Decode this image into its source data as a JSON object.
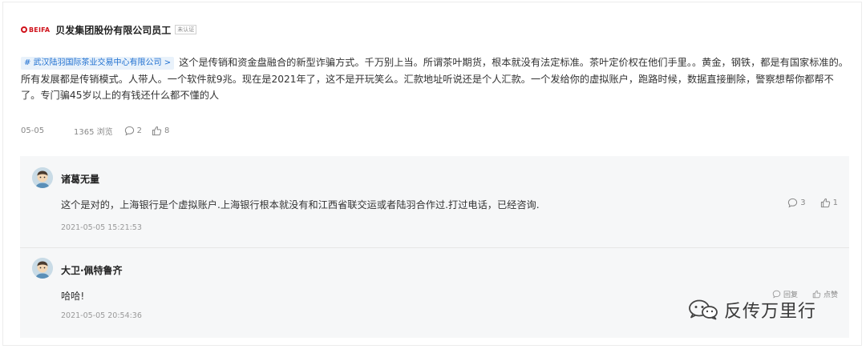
{
  "author": {
    "logo_text": "BEIFA",
    "name": "贝发集团股份有限公司员工",
    "badge": "未认证"
  },
  "post": {
    "topic": "# 武汉陆羽国际茶业交易中心有限公司 >",
    "content": "这个是传销和资金盘融合的新型诈骗方式。千万别上当。所谓茶叶期货，根本就没有法定标准。茶叶定价权在他们手里。。黄金，钢铁，都是有国家标准的。所有发展都是传销模式。人带人。一个软件就9兆。现在是2021年了，这不是开玩笑么。汇款地址听说还是个人汇款。一个发给你的虚拟账户，跑路时候，数据直接删除，警察想帮你都帮不了。专门骗45岁以上的有钱还什么都不懂的人",
    "date": "05-05",
    "views": "1365 浏览",
    "comments": "2",
    "likes": "8"
  },
  "comments": [
    {
      "name": "诸葛无量",
      "text": "这个是对的，上海银行是个虚拟账户.上海银行根本就没有和江西省联交运或者陆羽合作过.打过电话，已经咨询.",
      "time": "2021-05-05 15:21:53",
      "replies": "3",
      "likes": "1"
    },
    {
      "name": "大卫·佩特鲁齐",
      "text": "哈哈!",
      "time": "2021-05-05 20:54:36",
      "reply_label": "回复",
      "like_label": "点赞"
    }
  ],
  "watermark": {
    "text": "反传万里行"
  }
}
